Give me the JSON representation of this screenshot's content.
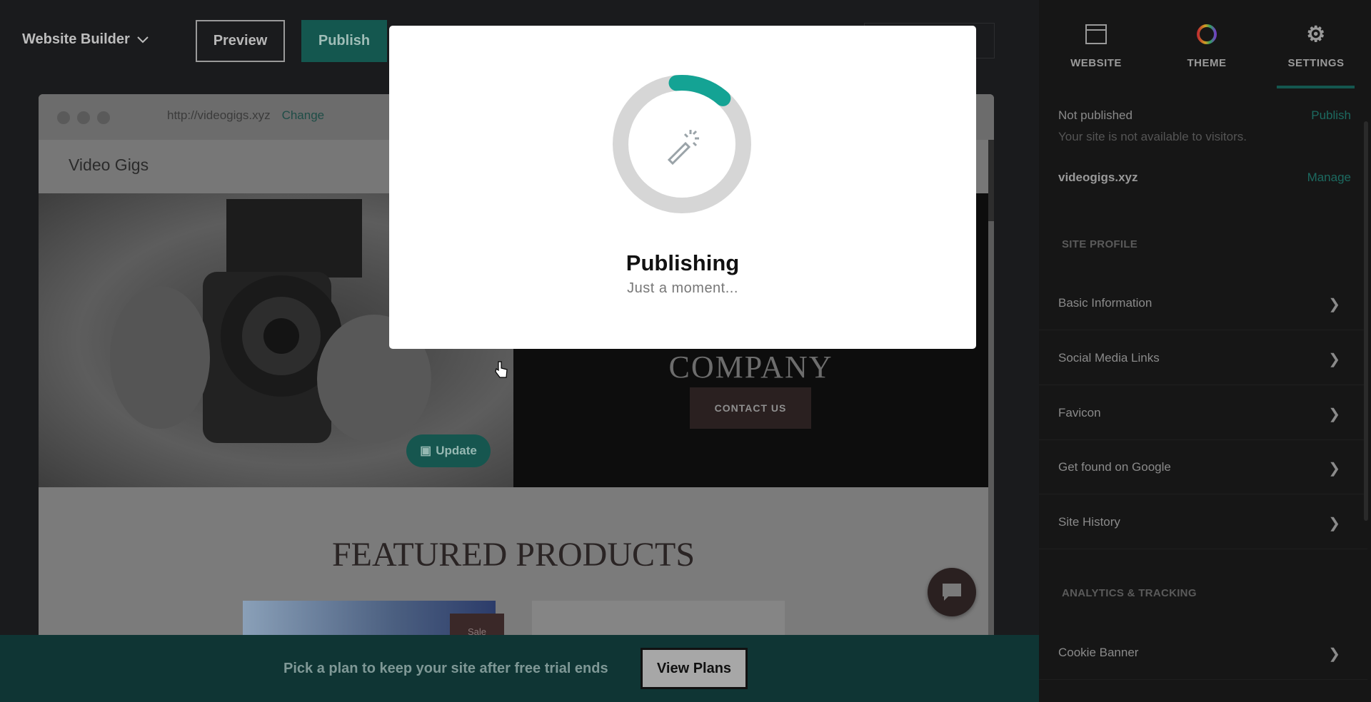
{
  "topbar": {
    "brand": "Website Builder",
    "preview_label": "Preview",
    "publish_label": "Publish"
  },
  "preview": {
    "url": "http://videogigs.xyz",
    "change_label": "Change",
    "site_name": "Video Gigs",
    "hero_heading_partial": "COMPANY",
    "contact_label": "CONTACT US",
    "update_label": "Update",
    "featured_title": "FEATURED PRODUCTS",
    "sale_badge": "Sale"
  },
  "banner": {
    "text": "Pick a plan to keep your site after free trial ends",
    "button_label": "View Plans"
  },
  "panel": {
    "tabs": [
      {
        "label": "WEBSITE",
        "icon": "browser-window-icon"
      },
      {
        "label": "THEME",
        "icon": "color-wheel-icon"
      },
      {
        "label": "SETTINGS",
        "icon": "gear-icon",
        "active": true
      }
    ],
    "status": "Not published",
    "status_link": "Publish",
    "status_desc": "Your site is not available to visitors.",
    "domain": "videogigs.xyz",
    "domain_link": "Manage",
    "section_profile": "SITE PROFILE",
    "profile_items": [
      "Basic Information",
      "Social Media Links",
      "Favicon",
      "Get found on Google",
      "Site History"
    ],
    "section_analytics": "ANALYTICS & TRACKING",
    "analytics_items": [
      "Cookie Banner"
    ]
  },
  "modal": {
    "title": "Publishing",
    "subtitle": "Just a moment...",
    "progress_fraction": 0.13
  },
  "colors": {
    "accent": "#14a394",
    "banner": "#0f3534",
    "panel": "#161616"
  }
}
